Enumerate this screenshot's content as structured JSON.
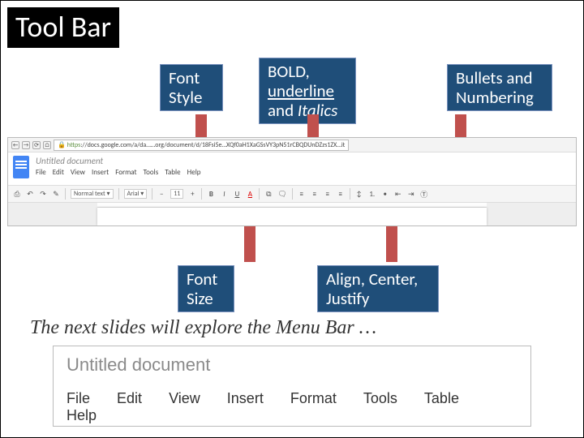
{
  "title": "Tool Bar",
  "labels": {
    "font_style": "Font Style",
    "bold": "BOLD,",
    "underline": "underline",
    "and": "and ",
    "italics": "Italics",
    "bullets": "Bullets and Numbering",
    "font_size": "Font Size",
    "align": "Align, Center, Justify"
  },
  "sentence": "The next slides will explore the Menu Bar …",
  "browser": {
    "back": "←",
    "fwd": "→",
    "reload": "⟳",
    "home": "⌂",
    "url_prefix": "https",
    "url": "://docs.google.com/a/da……org/document/d/18Fsi5e…XQf0aH1XaGSsVY3pN51rCBQDUnDZzs1ZX…it"
  },
  "gdocs": {
    "title": "Untitled document",
    "menu": [
      "File",
      "Edit",
      "View",
      "Insert",
      "Format",
      "Tools",
      "Table",
      "Help"
    ]
  },
  "toolbar": {
    "print": "⎙",
    "undo": "↶",
    "redo": "↷",
    "paint": "✎",
    "style": "Normal text",
    "font": "Arial",
    "size": "11",
    "minus": "−",
    "plus": "+",
    "B": "B",
    "I": "I",
    "U": "U",
    "A": "A",
    "link": "⧉",
    "comment": "🗨",
    "align_l": "≡",
    "align_c": "≡",
    "align_r": "≡",
    "align_j": "≡",
    "sp": "↕",
    "num": "1.",
    "bul": "•",
    "out": "⇤",
    "in": "⇥",
    "clear": "Ⓣ"
  },
  "detail": {
    "title": "Untitled document",
    "menu": [
      "File",
      "Edit",
      "View",
      "Insert",
      "Format",
      "Tools",
      "Table",
      "Help"
    ]
  }
}
